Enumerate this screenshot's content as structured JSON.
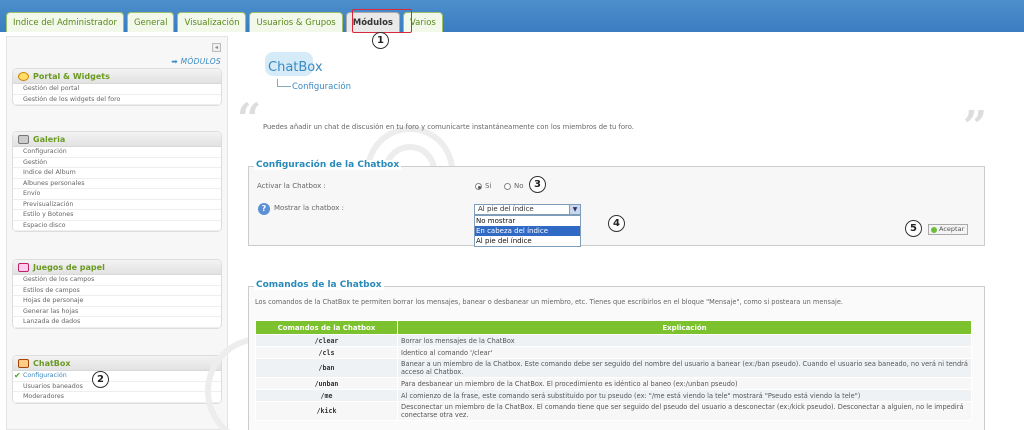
{
  "tabs": [
    "Indice del Administrador",
    "General",
    "Visualización",
    "Usuarios & Grupos",
    "Módulos",
    "Varios"
  ],
  "active_tab": "Módulos",
  "markers": [
    "1",
    "2",
    "3",
    "4",
    "5"
  ],
  "sidebar": {
    "modules_link": "➡ MÓDULOS",
    "collapse": "◂",
    "boxes": [
      {
        "title": "Portal & Widgets",
        "items": [
          "Gestión del portal",
          "Gestión de los widgets del foro"
        ]
      },
      {
        "title": "Galeria",
        "items": [
          "Configuración",
          "Gestión",
          "Indice del Album",
          "Albunes personales",
          "Envío",
          "Previsualización",
          "Estilo y Botones",
          "Espacio disco"
        ]
      },
      {
        "title": "Juegos de papel",
        "items": [
          "Gestión de los campos",
          "Estilos de campos",
          "Hojas de personaje",
          "Generar las hojas",
          "Lanzada de dados"
        ]
      },
      {
        "title": "ChatBox",
        "items": [
          "Configuración",
          "Usuarios baneados",
          "Moderadores"
        ]
      }
    ],
    "selected_item": "Configuración"
  },
  "page": {
    "title": "ChatBox",
    "subtitle": "Configuración",
    "description": "Puedes añadir un chat de discusión en tu foro y comunicarte instantáneamente con los miembros de tu foro.",
    "quote_open": "“",
    "quote_close": "”"
  },
  "config": {
    "legend": "Configuración de la Chatbox",
    "activate_label": "Activar la Chatbox :",
    "radio_yes": "Si",
    "radio_no": "No",
    "radio_selected": "Si",
    "show_label": "Mostrar la chatbox :",
    "select_value": "Al pie del índice",
    "options": [
      "No mostrar",
      "En cabeza del índice",
      "Al pie del índice"
    ],
    "highlighted_option": "En cabeza del índice",
    "accept": "Aceptar",
    "help_icon": "?"
  },
  "commands": {
    "legend": "Comandos de la Chatbox",
    "description": "Los comandos de la ChatBox te permiten borrar los mensajes, banear o desbanear un miembro, etc. Tienes que escribirlos en el bloque \"Mensaje\", como si posteara un mensaje.",
    "headers": [
      "Comandos de la Chatbox",
      "Explicación"
    ],
    "rows": [
      [
        "/clear",
        "Borrar los mensajes de la ChatBox"
      ],
      [
        "/cls",
        "Identico al comando '/clear'"
      ],
      [
        "/ban",
        "Banear a un miembro de la Chatbox. Este comando debe ser seguido del nombre del usuario a banear (ex:/ban pseudo). Cuando el usuario sea baneado, no verá ni tendrá acceso al Chatbox."
      ],
      [
        "/unban",
        "Para desbanear un miembro de la ChatBox. El procedimiento es idéntico al baneo (ex:/unban pseudo)"
      ],
      [
        "/me",
        "Al comienzo de la frase, este comando será substituido por tu pseudo (ex: \"/me está viendo la tele\" mostrará \"Pseudo está viendo la tele\")"
      ],
      [
        "/kick",
        "Desconectar un miembro de la ChatBox. El comando tiene que ser seguido del pseudo del usuario a desconectar (ex:/kick pseudo). Desconectar a alguien, no le impedirá conectarse otra vez."
      ]
    ]
  }
}
